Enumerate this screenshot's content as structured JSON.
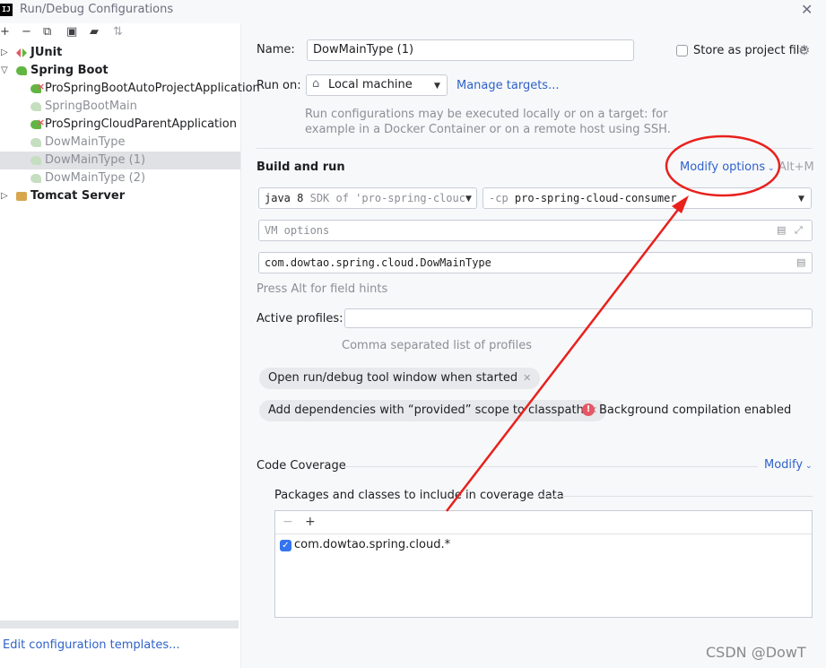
{
  "window": {
    "title": "Run/Debug Configurations",
    "app_icon_text": "IJ"
  },
  "tree": {
    "items": [
      {
        "label": "JUnit",
        "level": 0,
        "bold": true
      },
      {
        "label": "Spring Boot",
        "level": 0,
        "bold": true
      },
      {
        "label": "ProSpringBootAutoProjectApplication",
        "level": 1,
        "error": true
      },
      {
        "label": "SpringBootMain",
        "level": 1,
        "faded": true
      },
      {
        "label": "ProSpringCloudParentApplication",
        "level": 1,
        "error": true
      },
      {
        "label": "DowMainType",
        "level": 1,
        "faded": true
      },
      {
        "label": "DowMainType (1)",
        "level": 1,
        "faded": true,
        "selected": true
      },
      {
        "label": "DowMainType (2)",
        "level": 1,
        "faded": true
      },
      {
        "label": "Tomcat Server",
        "level": 0,
        "bold": true
      }
    ],
    "edit_templates_link": "Edit configuration templates..."
  },
  "form": {
    "name_label": "Name:",
    "name_value": "DowMainType (1)",
    "store_label": "Store as project file",
    "store_checked": false,
    "run_on_label": "Run on:",
    "run_on_value": "Local machine",
    "manage_targets": "Manage targets...",
    "run_on_hint_1": "Run configurations may be executed locally or on a target: for",
    "run_on_hint_2": "example in a Docker Container or on a remote host using SSH.",
    "build_run_title": "Build and run",
    "modify_options": "Modify options",
    "modify_shortcut": "Alt+M",
    "jdk_main": "java 8",
    "jdk_detail": "SDK of 'pro-spring-clouc",
    "cp_prefix": "-cp",
    "cp_value": "pro-spring-cloud-consumer",
    "vm_options_placeholder": "VM options",
    "main_class": "com.dowtao.spring.cloud.DowMainType",
    "alt_hint": "Press Alt for field hints",
    "active_profiles_label": "Active profiles:",
    "active_profiles_value": "",
    "profiles_hint": "Comma separated list of profiles",
    "chip_open_tool_window": "Open run/debug tool window when started",
    "chip_add_dependencies": "Add dependencies with “provided” scope to classpath",
    "background_compilation": "Background compilation enabled",
    "code_coverage_title": "Code Coverage",
    "coverage_modify": "Modify",
    "packages_title": "Packages and classes to include in coverage data",
    "coverage_entries": [
      {
        "pattern": "com.dowtao.spring.cloud.*",
        "checked": true
      }
    ]
  },
  "watermark": "CSDN @DowT",
  "colors": {
    "accent": "#2f62c9",
    "annotation_red": "#e8211d",
    "selection": "#dfe1e5"
  }
}
